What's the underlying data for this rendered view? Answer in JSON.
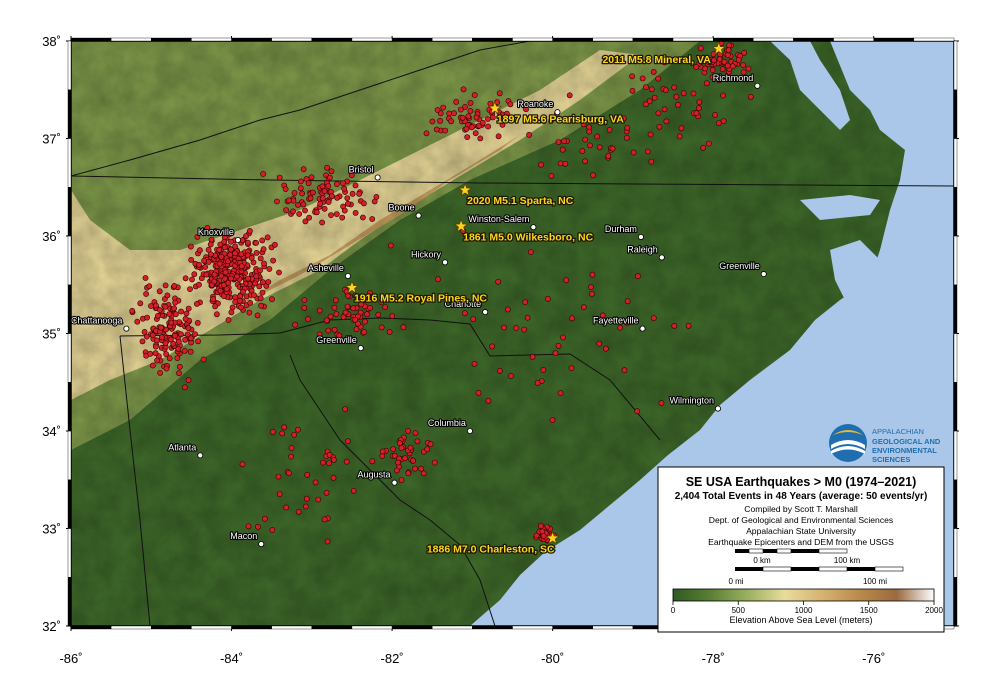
{
  "map": {
    "extent": {
      "lon_min": -86,
      "lon_max": -75,
      "lat_min": 32,
      "lat_max": 38
    },
    "lon_ticks": [
      {
        "value": -86,
        "label": "-86˚"
      },
      {
        "value": -84,
        "label": "-84˚"
      },
      {
        "value": -82,
        "label": "-82˚"
      },
      {
        "value": -80,
        "label": "-80˚"
      },
      {
        "value": -78,
        "label": "-78˚"
      },
      {
        "value": -76,
        "label": "-76˚"
      }
    ],
    "lat_ticks": [
      {
        "value": 38,
        "label": "38˚"
      },
      {
        "value": 37,
        "label": "37˚"
      },
      {
        "value": 36,
        "label": "36˚"
      },
      {
        "value": 35,
        "label": "35˚"
      },
      {
        "value": 34,
        "label": "34˚"
      },
      {
        "value": 33,
        "label": "33˚"
      },
      {
        "value": 32,
        "label": "32˚"
      }
    ],
    "colors": {
      "ocean": "#aac7ea",
      "lowland": "#3f6a2a",
      "midland": "#7f9a4a",
      "upland": "#e8d898",
      "highland": "#c9a060",
      "quake_fill": "#d31f2a",
      "star": "#ffd21f"
    },
    "cities": [
      {
        "name": "Richmond",
        "lon": -77.45,
        "lat": 37.54
      },
      {
        "name": "Roanoke",
        "lon": -79.94,
        "lat": 37.27
      },
      {
        "name": "Bristol",
        "lon": -82.18,
        "lat": 36.6
      },
      {
        "name": "Boone",
        "lon": -81.67,
        "lat": 36.21
      },
      {
        "name": "Winston-Salem",
        "lon": -80.24,
        "lat": 36.09
      },
      {
        "name": "Durham",
        "lon": -78.9,
        "lat": 35.99
      },
      {
        "name": "Raleigh",
        "lon": -78.64,
        "lat": 35.78
      },
      {
        "name": "Knoxville",
        "lon": -83.92,
        "lat": 35.96
      },
      {
        "name": "Hickory",
        "lon": -81.34,
        "lat": 35.73
      },
      {
        "name": "Asheville",
        "lon": -82.55,
        "lat": 35.59
      },
      {
        "name": "Greenville",
        "lon": -77.37,
        "lat": 35.61
      },
      {
        "name": "Charlotte",
        "lon": -80.84,
        "lat": 35.22
      },
      {
        "name": "Chattanooga",
        "lon": -85.31,
        "lat": 35.05
      },
      {
        "name": "Fayetteville",
        "lon": -78.88,
        "lat": 35.05
      },
      {
        "name": "Greenville",
        "lon": -82.39,
        "lat": 34.85
      },
      {
        "name": "Wilmington",
        "lon": -77.94,
        "lat": 34.23
      },
      {
        "name": "Columbia",
        "lon": -81.03,
        "lat": 34.0
      },
      {
        "name": "Atlanta",
        "lon": -84.39,
        "lat": 33.75
      },
      {
        "name": "Augusta",
        "lon": -81.97,
        "lat": 33.47
      },
      {
        "name": "Macon",
        "lon": -83.63,
        "lat": 32.84
      }
    ],
    "major_quakes": [
      {
        "label": "2011 M5.8 Mineral, VA",
        "lon": -77.93,
        "lat": 37.92
      },
      {
        "label": "1897 M5.6 Pearisburg, VA",
        "lon": -80.72,
        "lat": 37.31
      },
      {
        "label": "2020 M5.1 Sparta, NC",
        "lon": -81.09,
        "lat": 36.47
      },
      {
        "label": "1861 M5.0 Wilkesboro, NC",
        "lon": -81.14,
        "lat": 36.1
      },
      {
        "label": "1916 M5.2 Royal Pines, NC",
        "lon": -82.5,
        "lat": 35.47
      },
      {
        "label": "1886 M7.0 Charleston, SC",
        "lon": -80.0,
        "lat": 32.9
      }
    ],
    "earthquake_clusters": [
      {
        "lon": -84.0,
        "lat": 35.65,
        "spread_lon": 0.55,
        "spread_lat": 0.45,
        "count": 320
      },
      {
        "lon": -84.8,
        "lat": 35.0,
        "spread_lon": 0.45,
        "spread_lat": 0.55,
        "count": 150
      },
      {
        "lon": -82.8,
        "lat": 36.4,
        "spread_lon": 0.8,
        "spread_lat": 0.35,
        "count": 90
      },
      {
        "lon": -81.0,
        "lat": 37.2,
        "spread_lon": 0.6,
        "spread_lat": 0.3,
        "count": 60
      },
      {
        "lon": -77.9,
        "lat": 37.8,
        "spread_lon": 0.35,
        "spread_lat": 0.2,
        "count": 55
      },
      {
        "lon": -80.1,
        "lat": 32.95,
        "spread_lon": 0.12,
        "spread_lat": 0.1,
        "count": 30
      },
      {
        "lon": -81.8,
        "lat": 33.8,
        "spread_lon": 0.4,
        "spread_lat": 0.3,
        "count": 40
      },
      {
        "lon": -82.5,
        "lat": 35.2,
        "spread_lon": 0.7,
        "spread_lat": 0.35,
        "count": 60
      },
      {
        "lon": -80.0,
        "lat": 35.0,
        "spread_lon": 2.0,
        "spread_lat": 1.2,
        "count": 50
      },
      {
        "lon": -83.0,
        "lat": 33.5,
        "spread_lon": 1.0,
        "spread_lat": 0.8,
        "count": 40
      },
      {
        "lon": -79.5,
        "lat": 37.0,
        "spread_lon": 1.0,
        "spread_lat": 0.5,
        "count": 35
      },
      {
        "lon": -78.5,
        "lat": 37.3,
        "spread_lon": 1.0,
        "spread_lat": 0.5,
        "count": 40
      }
    ]
  },
  "legend": {
    "title": "SE USA Earthquakes > M0 (1974–2021)",
    "subtitle": "2,404 Total Events in 48 Years (average: 50 events/yr)",
    "credits": [
      "Compiled by Scott T. Marshall",
      "Dept. of Geological and Environmental Sciences",
      "Appalachian State University",
      "Earthquake Epicenters and DEM from the USGS"
    ],
    "scale_km": {
      "zero": "0 km",
      "max": "100 km"
    },
    "scale_mi": {
      "zero": "0 mi",
      "max": "100 mi"
    },
    "colorbar_ticks": [
      "0",
      "500",
      "1000",
      "1500",
      "2000"
    ],
    "colorbar_label": "Elevation Above Sea Level (meters)",
    "colorbar_colors": [
      "#2f5a22",
      "#5a7f35",
      "#9bb060",
      "#e9dc9d",
      "#d5b370",
      "#b98a4b",
      "#9a6a40",
      "#ffffff"
    ]
  },
  "logo": {
    "line1": "APPALACHIAN",
    "line2": "GEOLOGICAL AND",
    "line3": "ENVIRONMENTAL",
    "line4": "SCIENCES"
  }
}
